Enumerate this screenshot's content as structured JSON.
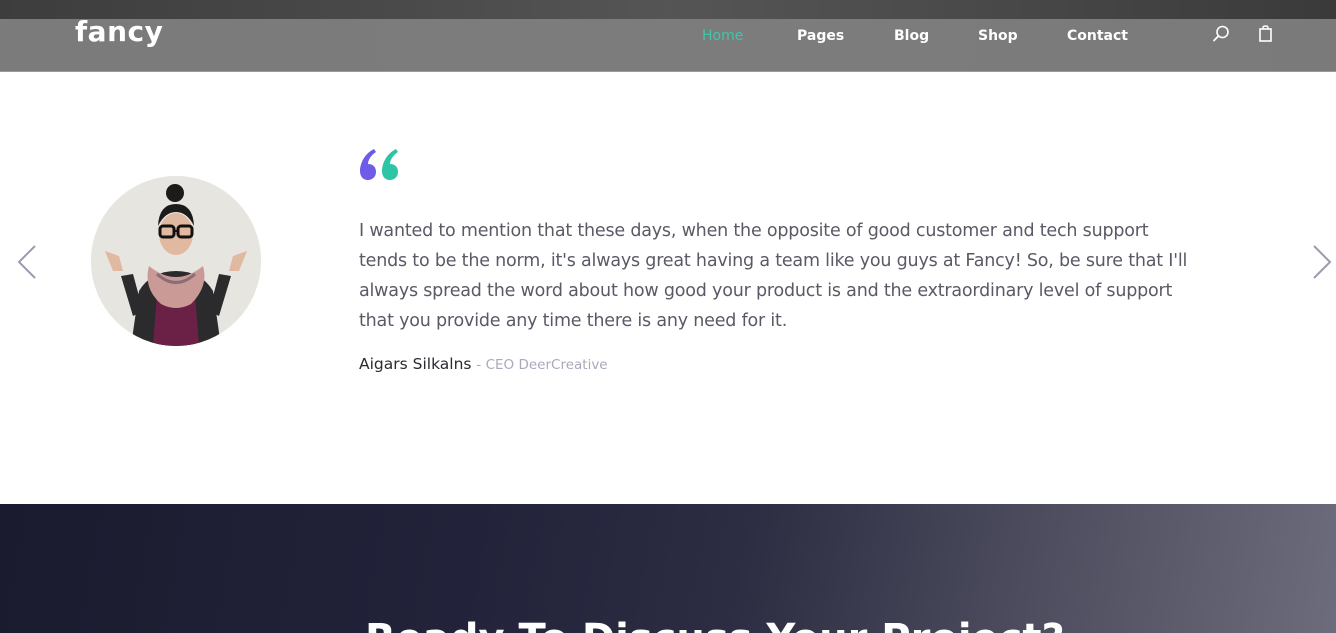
{
  "brand": {
    "logo_text": "fancy"
  },
  "nav": {
    "items": [
      {
        "label": "Home",
        "active": true
      },
      {
        "label": "Pages"
      },
      {
        "label": "Blog"
      },
      {
        "label": "Shop"
      },
      {
        "label": "Contact"
      }
    ],
    "icons": [
      "search-icon",
      "shopping-bag-icon"
    ],
    "active_color": "#3fc6a9"
  },
  "testimonial": {
    "quote_lines": [
      "I wanted to mention that these days, when the opposite of good customer and tech support",
      "tends to be the norm, it's always great having a team like you guys at Fancy! So, be sure that I'll",
      "always spread the word about how good your product is and the extraordinary level of support",
      "that you provide any time there is any need for it."
    ],
    "author_name": "Aigars Silkalns",
    "author_role": "- CEO DeerCreative",
    "quote_icon_colors": [
      "#6c5ce7",
      "#2ec4a6"
    ],
    "icons": [
      "chevron-left-icon",
      "chevron-right-icon",
      "quote-icon"
    ]
  },
  "cta": {
    "title": "Ready To Discuss Your Project?"
  }
}
